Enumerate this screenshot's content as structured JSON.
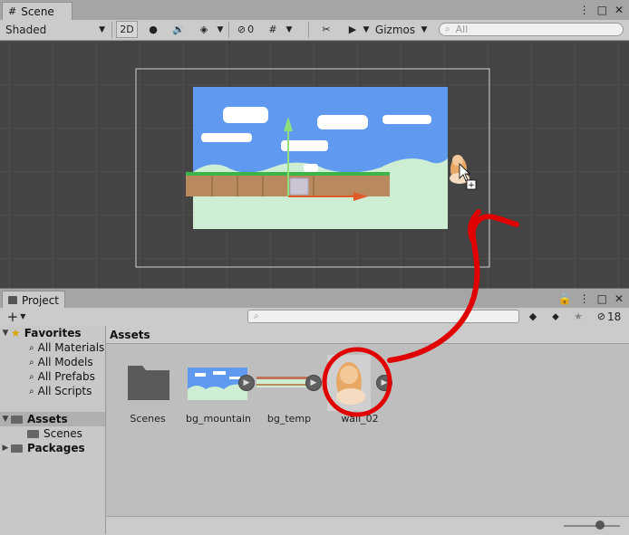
{
  "scene_window": {
    "tab_label": "Scene",
    "shading_mode": "Shaded",
    "toggle_2d": "2D",
    "hidden_count": "0",
    "gizmos_label": "Gizmos",
    "search_placeholder": "All"
  },
  "project_window": {
    "tab_label": "Project",
    "add_button": "+",
    "visible_count": "18",
    "tree": {
      "favorites": {
        "label": "Favorites",
        "items": [
          "All Materials",
          "All Models",
          "All Prefabs",
          "All Scripts"
        ]
      },
      "assets": {
        "label": "Assets",
        "children": [
          "Scenes"
        ]
      },
      "packages": {
        "label": "Packages"
      }
    },
    "assets_panel": {
      "header": "Assets",
      "items": [
        {
          "name": "Scenes"
        },
        {
          "name": "bg_mountain"
        },
        {
          "name": "bg_temp"
        },
        {
          "name": "wall_02"
        }
      ]
    },
    "zoom_slider": 0.65
  },
  "colors": {
    "annotation_red": "#e00000",
    "sky_blue": "#5f9af0",
    "ground_brown": "#b98a5e",
    "grass_green": "#3cb44a",
    "hill_light": "#cdeed3",
    "viewport_bg": "#444444"
  }
}
